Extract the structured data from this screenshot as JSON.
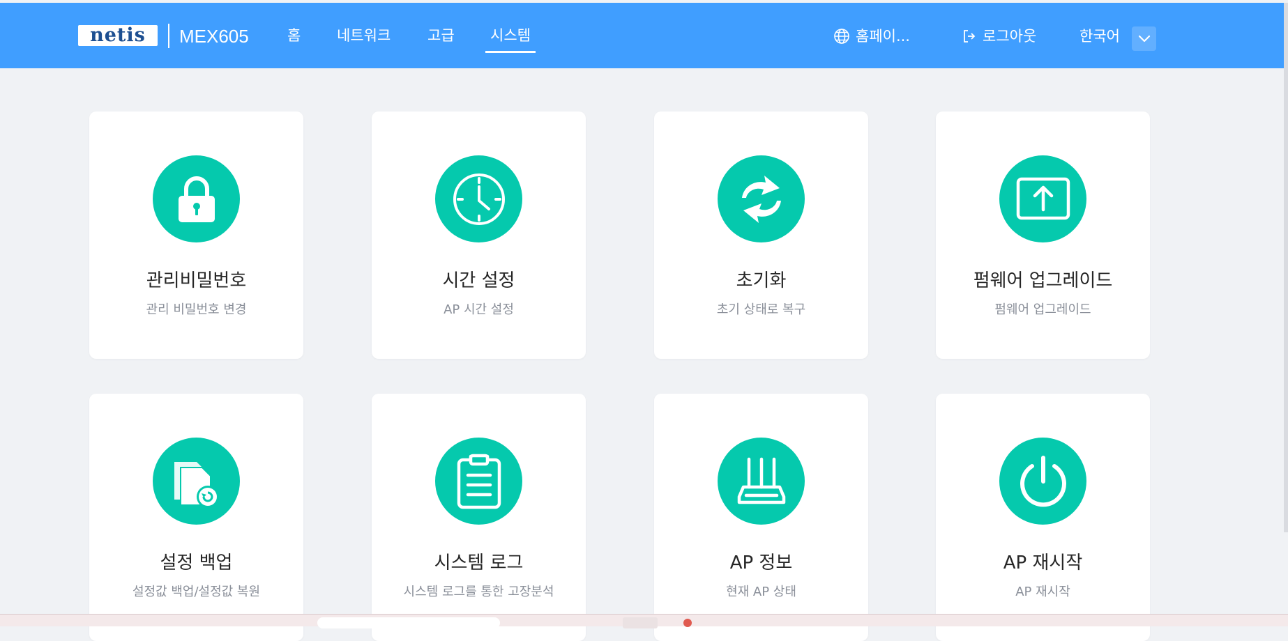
{
  "header": {
    "logo": "netis",
    "model": "MEX605",
    "nav": [
      {
        "label": "홈"
      },
      {
        "label": "네트워크"
      },
      {
        "label": "고급"
      },
      {
        "label": "시스템",
        "active": true
      }
    ],
    "homepage_label": "홈페이...",
    "logout_label": "로그아웃",
    "language": "한국어"
  },
  "cards": [
    {
      "title": "관리비밀번호",
      "subtitle": "관리 비밀번호 변경",
      "icon": "lock-icon"
    },
    {
      "title": "시간 설정",
      "subtitle": "AP 시간 설정",
      "icon": "clock-icon"
    },
    {
      "title": "초기화",
      "subtitle": "초기 상태로 복구",
      "icon": "reset-icon"
    },
    {
      "title": "펌웨어 업그레이드",
      "subtitle": "펌웨어 업그레이드",
      "icon": "upload-icon"
    },
    {
      "title": "설정 백업",
      "subtitle": "설정값 백업/설정값 복원",
      "icon": "backup-icon"
    },
    {
      "title": "시스템 로그",
      "subtitle": "시스템 로그를 통한 고장분석",
      "icon": "clipboard-icon"
    },
    {
      "title": "AP 정보",
      "subtitle": "현재 AP 상태",
      "icon": "router-icon"
    },
    {
      "title": "AP 재시작",
      "subtitle": "AP 재시작",
      "icon": "power-icon"
    }
  ],
  "colors": {
    "header_bg": "#409eff",
    "icon_bg": "#05c9ad",
    "page_bg": "#f0f2f5"
  }
}
